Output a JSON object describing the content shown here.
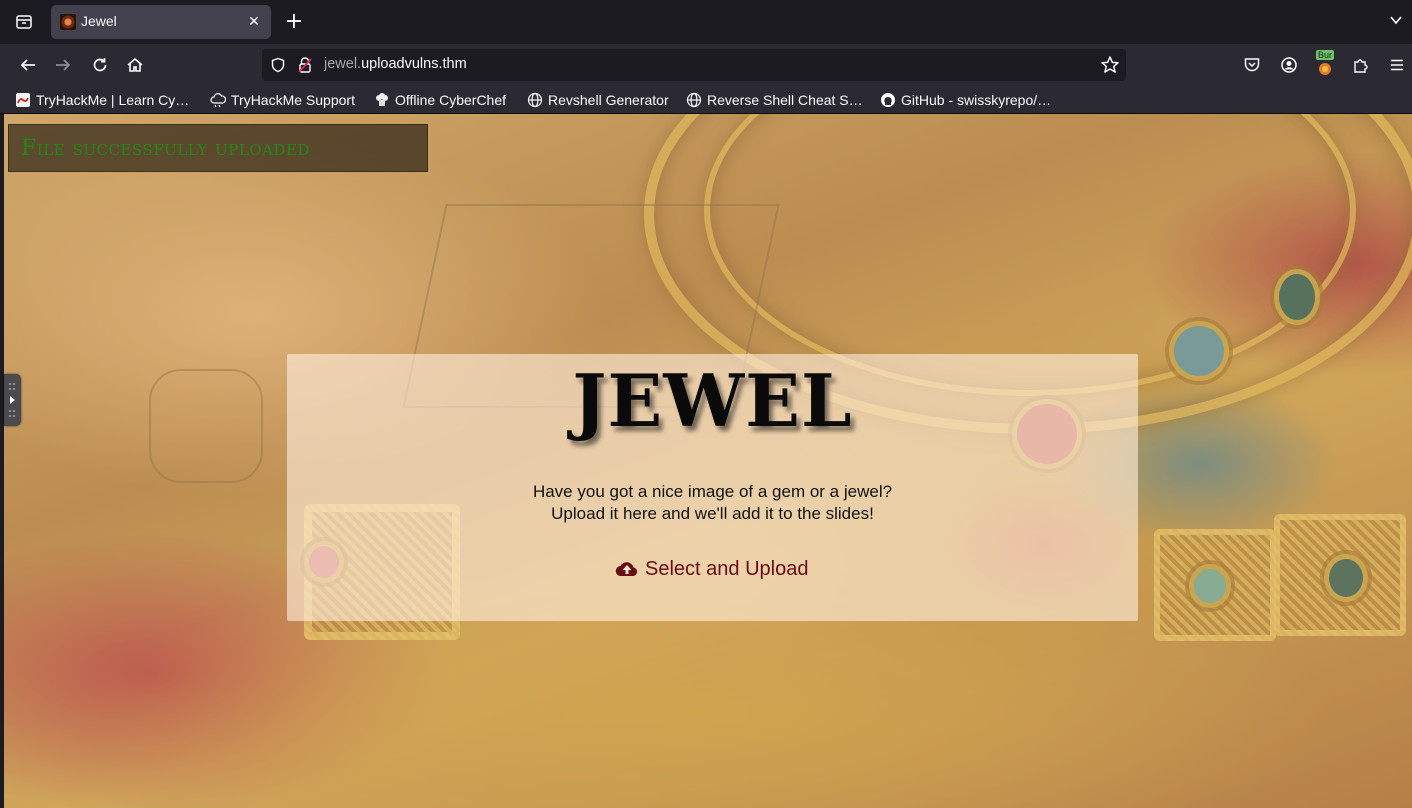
{
  "browser": {
    "tab": {
      "title": "Jewel"
    },
    "url": {
      "subdomain": "jewel.",
      "domain": "uploadvulns.thm"
    },
    "bookmarks": [
      {
        "label": "TryHackMe | Learn Cy…",
        "icon": "tryhackme-icon"
      },
      {
        "label": "TryHackMe Support",
        "icon": "support-cloud-icon"
      },
      {
        "label": "Offline CyberChef",
        "icon": "chef-icon"
      },
      {
        "label": "Revshell Generator",
        "icon": "globe-icon"
      },
      {
        "label": "Reverse Shell Cheat S…",
        "icon": "globe-icon"
      },
      {
        "label": "GitHub - swisskyrepo/…",
        "icon": "github-icon"
      }
    ],
    "extension_badge": "Bur"
  },
  "page": {
    "status_message": "File successfully uploaded",
    "heading": "JEWEL",
    "intro_line1": "Have you got a nice image of a gem or a jewel?",
    "intro_line2": "Upload it here and we'll add it to the slides!",
    "upload_label": "Select and Upload",
    "upload_icon": "cloud-upload-icon"
  },
  "colors": {
    "status_text": "#1f8a12",
    "upload_link": "#6b0a12"
  }
}
